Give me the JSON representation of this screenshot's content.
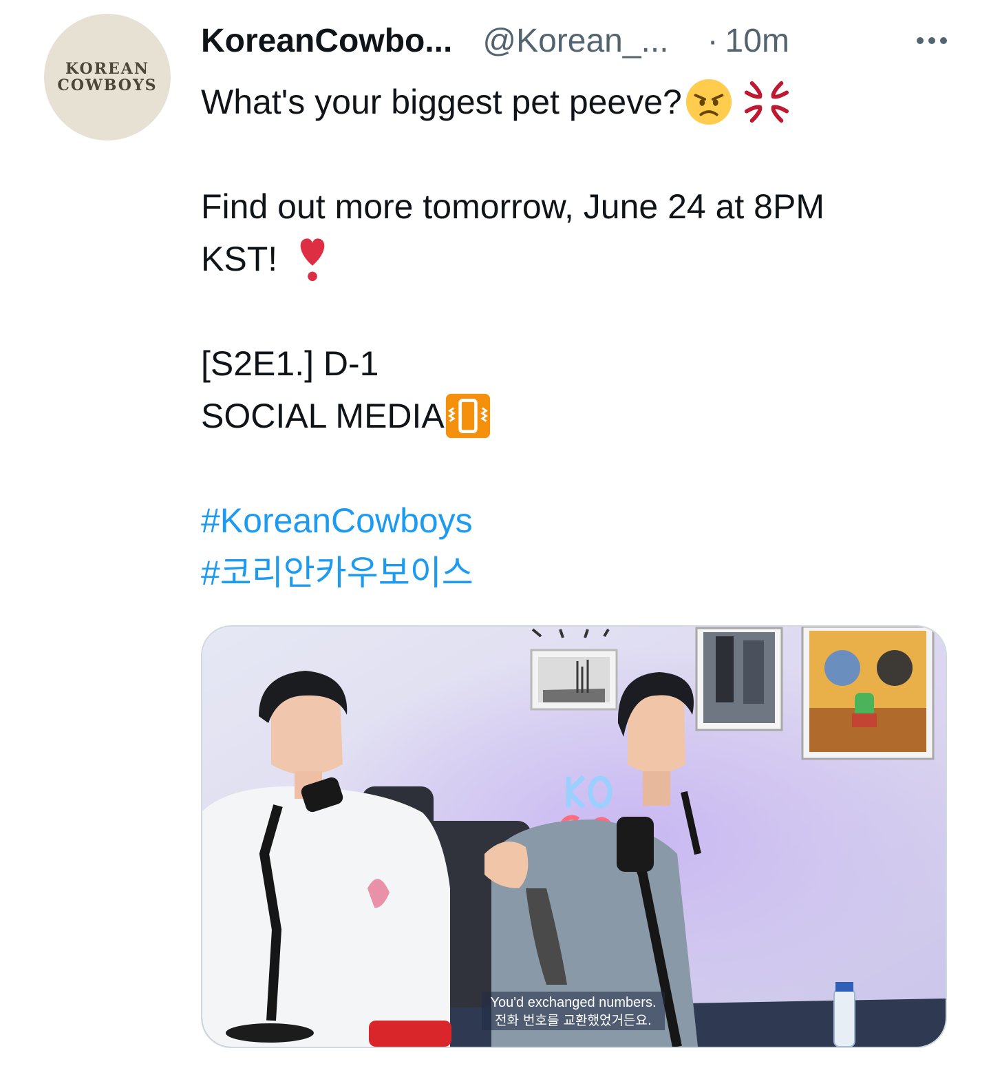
{
  "avatar": {
    "line1": "KOREAN",
    "line2": "COWBOYS"
  },
  "tweet": {
    "display_name": "KoreanCowbo...",
    "handle": "@Korean_...",
    "separator": "·",
    "time": "10m",
    "lines": {
      "l1": "What's your biggest pet peeve?",
      "l2": "Find out more tomorrow, June 24 at 8PM",
      "l3": "KST!",
      "l4": "[S2E1.] D-1",
      "l5": "SOCIAL MEDIA"
    },
    "hashtags": [
      "#KoreanCowboys",
      "#코리안카우보이스"
    ]
  },
  "icons": {
    "l1": [
      "angry-face-emoji",
      "anger-symbol-emoji"
    ],
    "l3": "heavy-exclamation-emoji",
    "l5": "vibration-mode-emoji",
    "more": "more-options-icon"
  },
  "media": {
    "subtitle_en": "You'd exchanged numbers.",
    "subtitle_ko": "전화 번호를 교환했었거든요."
  },
  "colors": {
    "hashtag": "#1d9bf0",
    "secondary_text": "#536471",
    "emoji_orange": "#f4900c",
    "anger_red": "#be1931"
  }
}
